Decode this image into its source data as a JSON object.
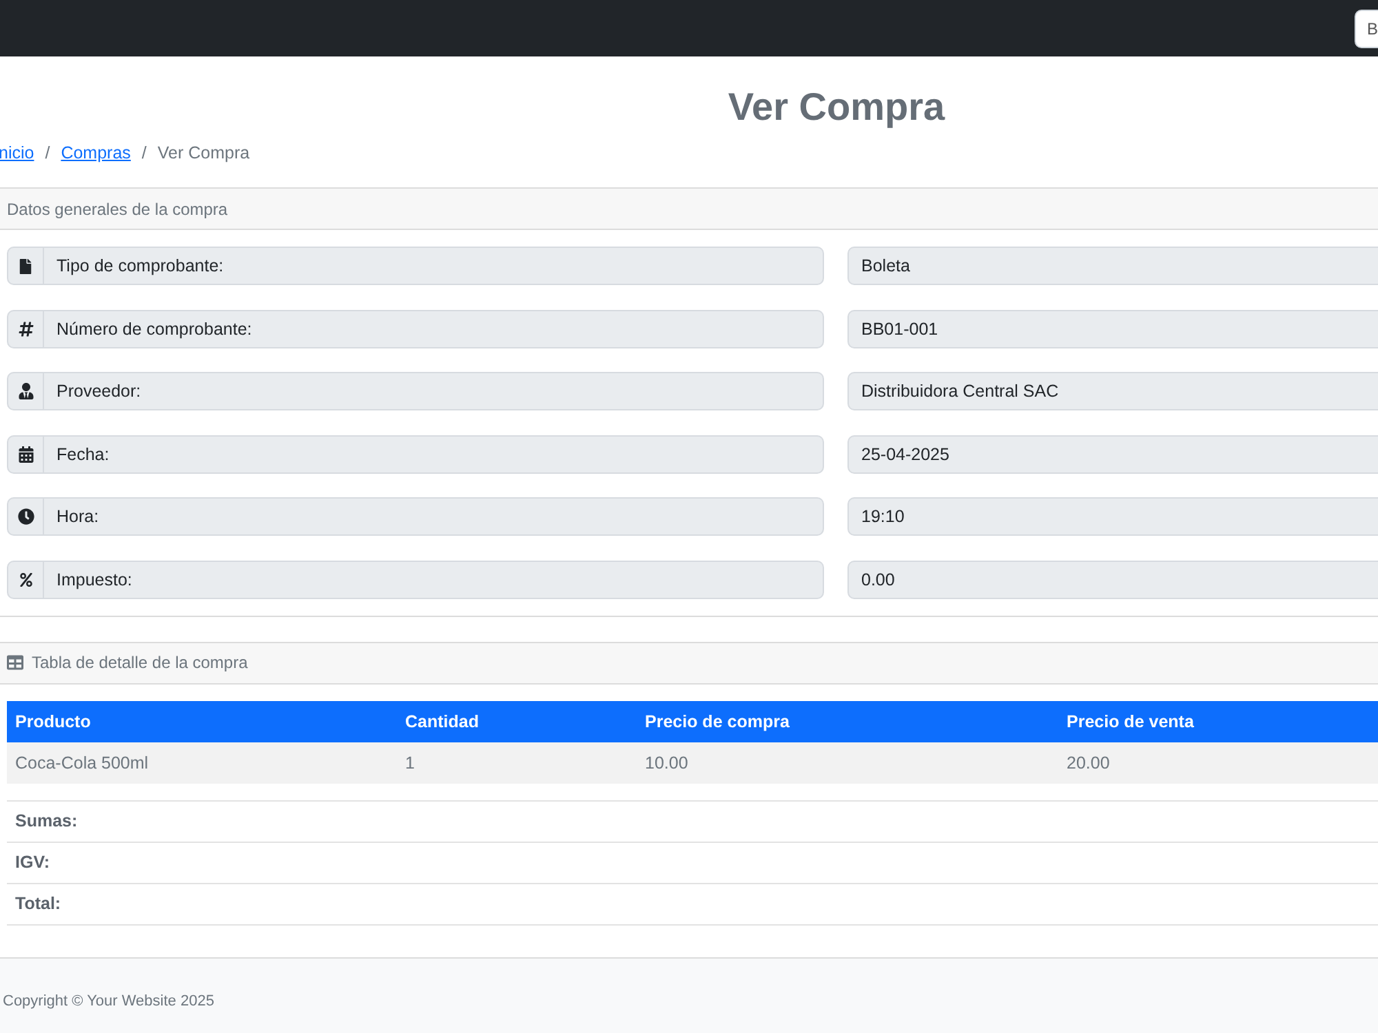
{
  "navbar": {
    "search": {
      "placeholder": "B"
    }
  },
  "page_title": "Ver Compra",
  "breadcrumb": [
    {
      "label": "nicio",
      "kind": "link"
    },
    {
      "separator": "/",
      "label": "Compras",
      "kind": "link"
    },
    {
      "separator": "/",
      "label": "Ver Compra",
      "kind": "current"
    }
  ],
  "general_card": {
    "header": "Datos generales de la compra",
    "fields": [
      {
        "kind": "document",
        "label": "Tipo de comprobante:",
        "value": "Boleta"
      },
      {
        "kind": "number",
        "label": "Número de comprobante:",
        "value": "BB01-001"
      },
      {
        "kind": "person",
        "label": "Proveedor:",
        "value": "Distribuidora Central SAC"
      },
      {
        "kind": "date",
        "label": "Fecha:",
        "value": "25-04-2025"
      },
      {
        "kind": "time",
        "label": "Hora:",
        "value": "19:10"
      },
      {
        "kind": "tax",
        "label": "Impuesto:",
        "value": "0.00"
      }
    ]
  },
  "detail_card": {
    "header": "Tabla de detalle de la compra",
    "table": {
      "columns": [
        "Producto",
        "Cantidad",
        "Precio de compra",
        "Precio de venta"
      ],
      "rows": [
        [
          "Coca-Cola 500ml",
          "1",
          "10.00",
          "20.00"
        ]
      ]
    },
    "totals": [
      {
        "label": "Sumas:"
      },
      {
        "label": "IGV:"
      },
      {
        "label": "Total:"
      }
    ]
  },
  "footer": {
    "text": "Copyright © Your Website 2025"
  }
}
